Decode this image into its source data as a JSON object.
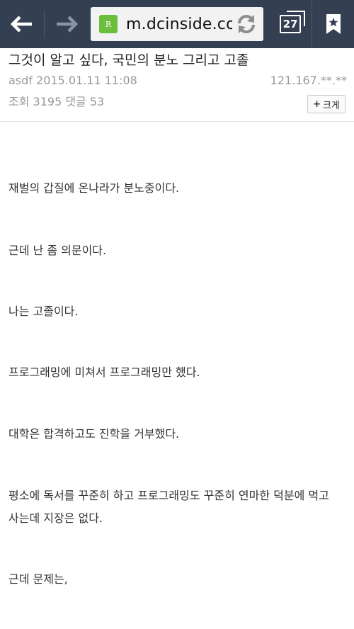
{
  "browser": {
    "url": "m.dcinside.co",
    "site_icon_letter": "R",
    "tab_count": "27"
  },
  "post": {
    "title": "그것이 알고 싶다, 국민의 분노 그리고 고졸",
    "author_date": "asdf 2015.01.11 11:08",
    "ip": "121.167.**.**",
    "stats": "조회 3195  댓글 53",
    "enlarge_label": "크게",
    "paragraphs": [
      "재벌의 갑질에 온나라가 분노중이다.",
      "근데 난 좀 의문이다.",
      "나는 고졸이다.",
      "프로그래밍에 미쳐서 프로그래밍만 했다.",
      "대학은 합격하고도 진학을 거부했다.",
      "평소에 독서를 꾸준히 하고 프로그래밍도 꾸준히 연마한 덕분에 먹고",
      "사는데 지장은 없다.",
      "근데 문제는,"
    ]
  }
}
